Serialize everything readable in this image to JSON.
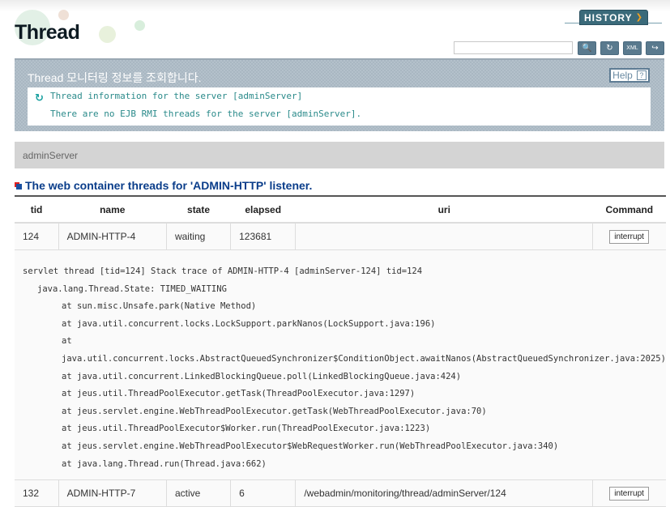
{
  "header": {
    "title": "Thread",
    "history_label": "HISTORY",
    "search_placeholder": "",
    "toolbar": [
      "search",
      "refresh",
      "export-xml",
      "export"
    ]
  },
  "info": {
    "title": "Thread 모니터링 정보를 조회합니다.",
    "help_label": "Help",
    "lines": [
      "Thread information for the server [adminServer]",
      "There are no EJB RMI threads for the server [adminServer]."
    ]
  },
  "server_name": "adminServer",
  "section_title": "The web container threads for 'ADMIN-HTTP' listener.",
  "table": {
    "headers": [
      "tid",
      "name",
      "state",
      "elapsed",
      "uri",
      "Command"
    ],
    "rows": [
      {
        "tid": "124",
        "name": "ADMIN-HTTP-4",
        "state": "waiting",
        "elapsed": "123681",
        "uri": "",
        "command": "interrupt"
      },
      {
        "tid": "132",
        "name": "ADMIN-HTTP-7",
        "state": "active",
        "elapsed": "6",
        "uri": "/webadmin/monitoring/thread/adminServer/124",
        "command": "interrupt"
      }
    ],
    "stack_trace": {
      "header": "servlet thread [tid=124] Stack trace of ADMIN-HTTP-4 [adminServer-124] tid=124",
      "state": "java.lang.Thread.State: TIMED_WAITING",
      "frames": [
        "at sun.misc.Unsafe.park(Native Method)",
        "at java.util.concurrent.locks.LockSupport.parkNanos(LockSupport.java:196)",
        "at java.util.concurrent.locks.AbstractQueuedSynchronizer$ConditionObject.awaitNanos(AbstractQueuedSynchronizer.java:2025)",
        "at java.util.concurrent.LinkedBlockingQueue.poll(LinkedBlockingQueue.java:424)",
        "at jeus.util.ThreadPoolExecutor.getTask(ThreadPoolExecutor.java:1297)",
        "at jeus.servlet.engine.WebThreadPoolExecutor.getTask(WebThreadPoolExecutor.java:70)",
        "at jeus.util.ThreadPoolExecutor$Worker.run(ThreadPoolExecutor.java:1223)",
        "at jeus.servlet.engine.WebThreadPoolExecutor$WebRequestWorker.run(WebThreadPoolExecutor.java:340)",
        "at java.lang.Thread.run(Thread.java:662)"
      ]
    }
  }
}
